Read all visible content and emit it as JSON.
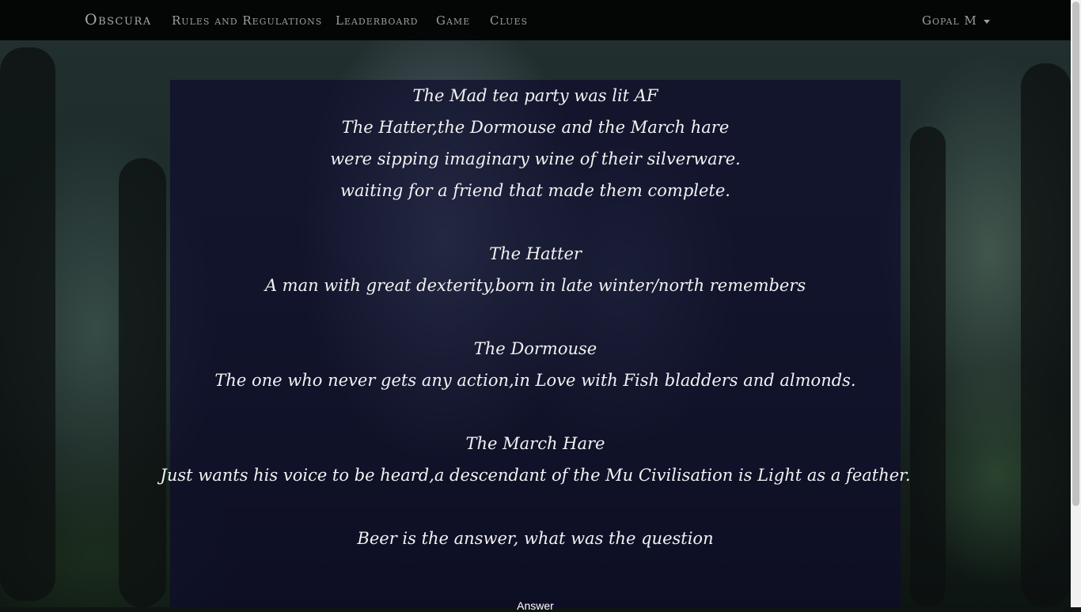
{
  "navbar": {
    "brand": "Obscura",
    "links": [
      "Rules and Regulations",
      "Leaderboard",
      "Game",
      "Clues"
    ],
    "user": "Gopal M"
  },
  "riddle": {
    "stanza1": [
      "The Mad tea party was lit AF",
      "The Hatter,the Dormouse and the March hare",
      "were sipping imaginary wine of their silverware.",
      "waiting for a friend that made them complete."
    ],
    "hatter_title": "The Hatter",
    "hatter_clue": "A man with great dexterity,born in late winter/north remembers",
    "dormouse_title": "The Dormouse",
    "dormouse_clue": "The one who never gets any action,in Love with Fish bladders and almonds.",
    "hare_title": "The March Hare",
    "hare_clue": "Just wants his voice to be heard,a descendant of the Mu Civilisation is Light as a feather.",
    "closing": "Beer is the answer, what was the question"
  },
  "answer_label": "Answer"
}
